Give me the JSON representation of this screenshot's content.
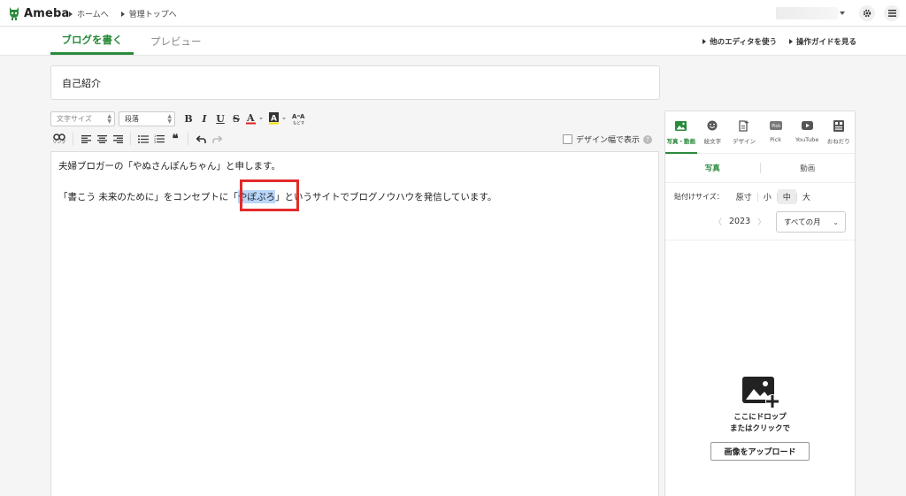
{
  "brand": {
    "logo_text": "Ameba",
    "accent": "#2a8a3c"
  },
  "breadcrumbs": [
    "ホームへ",
    "管理トップへ"
  ],
  "tabs": {
    "write": "ブログを書く",
    "preview": "プレビュー"
  },
  "header_links": [
    "他のエディタを使う",
    "操作ガイドを見る"
  ],
  "title_field": {
    "value": "自己紹介"
  },
  "toolbar": {
    "font_size_label": "文字サイズ",
    "paragraph_label": "段落",
    "link_label": "リンク",
    "design_width_label": "デザイン幅で表示"
  },
  "editor": {
    "line1": "夫婦ブロガーの「やぬさんぽんちゃん」と申します。",
    "line2_before": "「書こう 未来のために」をコンセプトに「",
    "line2_highlight": "やぽぷろ",
    "line2_after": "」というサイトでブログノウハウを発信しています。"
  },
  "side_panel": {
    "tabs": [
      "写真・動画",
      "絵文字",
      "デザイン",
      "Pick",
      "YouTube",
      "おねだり"
    ],
    "subtabs": [
      "写真",
      "動画"
    ],
    "paste_size_label": "貼付けサイズ：",
    "sizes": [
      "原寸",
      "小",
      "中",
      "大"
    ],
    "year": "2023",
    "month_select": "すべての月",
    "drop_line1": "ここにドロップ",
    "drop_line2": "またはクリックで",
    "upload_button": "画像をアップロード"
  }
}
